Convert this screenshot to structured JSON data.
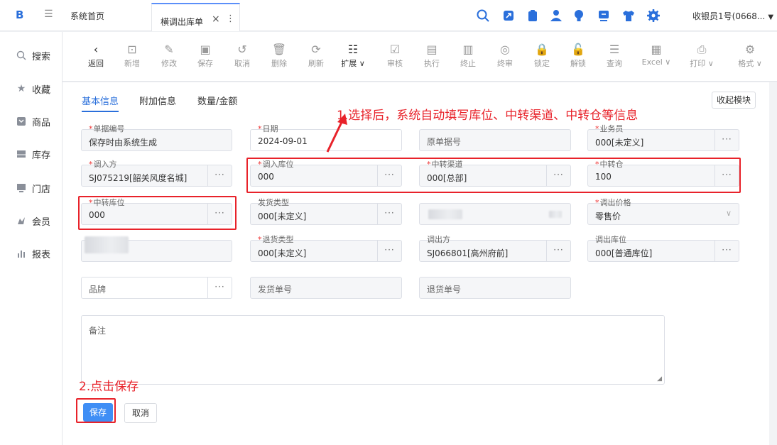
{
  "topbar": {
    "logo": "B",
    "home_tab": "系统首页",
    "active_tab": "横调出库单",
    "close_glyph": "×",
    "more_glyph": "⋮",
    "user": "收银员1号(0668...",
    "icons": [
      "search-icon",
      "resize-icon",
      "clipboard-icon",
      "user-icon",
      "bulb-icon",
      "screen-icon",
      "shirt-icon",
      "gear-icon"
    ]
  },
  "sidebar": {
    "items": [
      {
        "label": "搜索",
        "icon": "search-icon"
      },
      {
        "label": "收藏",
        "icon": "star-icon"
      },
      {
        "label": "商品",
        "icon": "goods-icon"
      },
      {
        "label": "库存",
        "icon": "stock-icon"
      },
      {
        "label": "门店",
        "icon": "store-icon"
      },
      {
        "label": "会员",
        "icon": "member-icon"
      },
      {
        "label": "报表",
        "icon": "report-icon"
      }
    ]
  },
  "toolbar": {
    "buttons": [
      {
        "label": "返回",
        "glyph": "‹",
        "enabled": true
      },
      {
        "label": "新增",
        "glyph": "⊡",
        "enabled": false
      },
      {
        "label": "修改",
        "glyph": "✎",
        "enabled": false
      },
      {
        "label": "保存",
        "glyph": "▣",
        "enabled": false
      },
      {
        "label": "取消",
        "glyph": "↺",
        "enabled": false
      },
      {
        "label": "删除",
        "glyph": "🗑",
        "enabled": false
      },
      {
        "label": "刷新",
        "glyph": "⟳",
        "enabled": false
      },
      {
        "label": "扩展 ∨",
        "glyph": "☷",
        "enabled": true
      },
      {
        "label": "审核",
        "glyph": "☑",
        "enabled": false
      },
      {
        "label": "执行",
        "glyph": "▤",
        "enabled": false
      },
      {
        "label": "终止",
        "glyph": "▥",
        "enabled": false
      },
      {
        "label": "终审",
        "glyph": "◎",
        "enabled": false
      },
      {
        "label": "锁定",
        "glyph": "🔒",
        "enabled": false
      },
      {
        "label": "解锁",
        "glyph": "🔓",
        "enabled": false
      },
      {
        "label": "查询",
        "glyph": "☰",
        "enabled": false
      },
      {
        "label": "Excel ∨",
        "glyph": "▦",
        "enabled": false
      },
      {
        "label": "打印 ∨",
        "glyph": "⎙",
        "enabled": false
      },
      {
        "label": "格式 ∨",
        "glyph": "⚙",
        "enabled": false
      }
    ]
  },
  "panel": {
    "tabs": [
      "基本信息",
      "附加信息",
      "数量/金额"
    ],
    "collapse": "收起模块",
    "fields": {
      "doc_no": {
        "label": "单据编号",
        "required": true,
        "value": "保存时由系统生成"
      },
      "date": {
        "label": "日期",
        "required": true,
        "value": "2024-09-01"
      },
      "orig_no": {
        "placeholder": "原单据号"
      },
      "salesman": {
        "label": "业务员",
        "required": true,
        "value": "000[未定义]"
      },
      "in_party": {
        "label": "调入方",
        "required": true,
        "value": "SJ075219[韶关风度名城]"
      },
      "in_loc": {
        "label": "调入库位",
        "required": true,
        "value": "000"
      },
      "transit_channel": {
        "label": "中转渠道",
        "required": true,
        "value": "000[总部]"
      },
      "transit_wh": {
        "label": "中转仓",
        "required": true,
        "value": "100"
      },
      "transit_loc": {
        "label": "中转库位",
        "required": true,
        "value": "000"
      },
      "ship_type": {
        "label": "发货类型",
        "required": false,
        "value": "000[未定义]"
      },
      "out_price": {
        "label": "调出价格",
        "required": true,
        "value": "零售价"
      },
      "return_type": {
        "label": "退货类型",
        "required": true,
        "value": "000[未定义]"
      },
      "out_party": {
        "label": "调出方",
        "required": false,
        "value": "SJ066801[高州府前]"
      },
      "out_loc": {
        "label": "调出库位",
        "required": false,
        "value": "000[普通库位]"
      },
      "brand": {
        "placeholder": "品牌"
      },
      "ship_no": {
        "placeholder": "发货单号"
      },
      "return_no": {
        "placeholder": "退货单号"
      },
      "remark": {
        "placeholder": "备注"
      }
    },
    "dots": "···",
    "required_mark": "*",
    "save": "保存",
    "cancel": "取消"
  },
  "annotations": {
    "note1": "1.选择后，系统自动填写库位、中转渠道、中转仓等信息",
    "note2": "2.点击保存",
    "color": "#e8222a"
  }
}
